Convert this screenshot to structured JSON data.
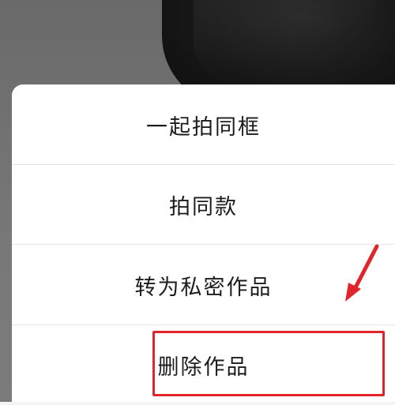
{
  "action_sheet": {
    "options": [
      {
        "label": "一起拍同框"
      },
      {
        "label": "拍同款"
      },
      {
        "label": "转为私密作品"
      },
      {
        "label": "删除作品"
      }
    ]
  },
  "annotations": {
    "highlight_color": "#e0262b",
    "highlighted_option": "删除作品",
    "arrow_icon": "red-arrow-pointing-down-left"
  }
}
